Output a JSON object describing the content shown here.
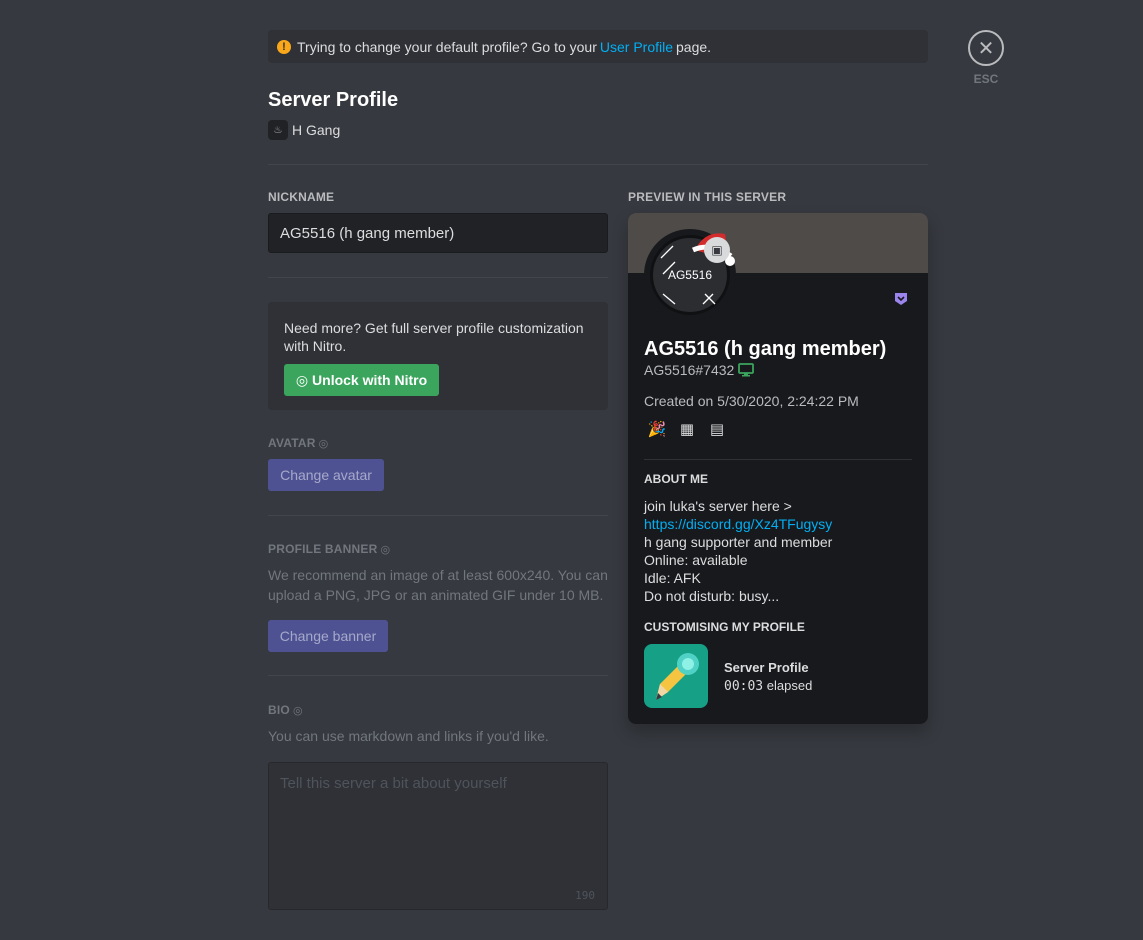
{
  "notice": {
    "text_before": "Trying to change your default profile? Go to your",
    "link": "User Profile",
    "text_after": "page."
  },
  "close": {
    "esc_label": "ESC"
  },
  "header": {
    "title": "Server Profile",
    "server_name": "H Gang"
  },
  "nickname": {
    "label": "NICKNAME",
    "value": "AG5516 (h gang member)"
  },
  "upsell": {
    "text": "Need more? Get full server profile customization with Nitro.",
    "button": "Unlock with Nitro"
  },
  "avatar_section": {
    "label": "AVATAR",
    "button": "Change avatar"
  },
  "banner_section": {
    "label": "PROFILE BANNER",
    "hint": "We recommend an image of at least 600x240. You can upload a PNG, JPG or an animated GIF under 10 MB.",
    "button": "Change banner"
  },
  "bio_section": {
    "label": "BIO",
    "hint": "You can use markdown and links if you'd like.",
    "placeholder": "Tell this server a bit about yourself",
    "remaining": "190"
  },
  "preview": {
    "label": "PREVIEW IN THIS SERVER",
    "avatar_text": "AG5516",
    "nickname": "AG5516 (h gang member)",
    "tag": "AG5516#7432",
    "created": "Created on 5/30/2020, 2:24:22 PM",
    "about_title": "ABOUT ME",
    "about_lines": [
      "join luka's server here >",
      "https://discord.gg/Xz4TFugysy",
      "h gang supporter and member",
      "Online: available",
      "Idle: AFK",
      "Do not disturb: busy..."
    ],
    "activity_title": "CUSTOMISING MY PROFILE",
    "activity_name": "Server Profile",
    "activity_time": "00:03",
    "activity_suffix": "elapsed"
  },
  "colors": {
    "background": "#36393f",
    "card": "#18191c",
    "nitro_green": "#3ba55d",
    "link": "#00aff4",
    "blurple_disabled": "#4e5293"
  }
}
